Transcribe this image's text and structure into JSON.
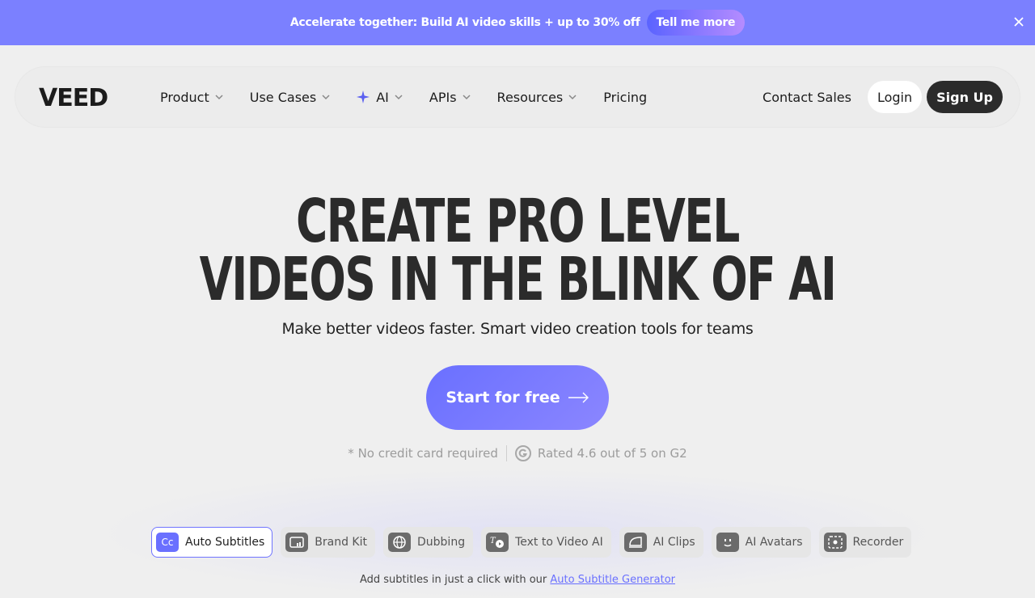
{
  "banner": {
    "text": "Accelerate together: Build AI video skills + up to 30% off",
    "button": "Tell me more",
    "close_icon": "close-icon",
    "color": "#7b80ff"
  },
  "nav": {
    "logo": "VEED",
    "items": [
      {
        "label": "Product",
        "dropdown": true
      },
      {
        "label": "Use Cases",
        "dropdown": true
      },
      {
        "label": "AI",
        "dropdown": true,
        "icon": "sparkle-icon"
      },
      {
        "label": "APIs",
        "dropdown": true
      },
      {
        "label": "Resources",
        "dropdown": true
      },
      {
        "label": "Pricing",
        "dropdown": false
      }
    ],
    "contact": "Contact Sales",
    "login": "Login",
    "signup": "Sign Up"
  },
  "hero": {
    "title_line1": "CREATE PRO LEVEL",
    "title_line2": "VIDEOS IN THE BLINK OF AI",
    "subtitle": "Make better videos faster. Smart video creation tools for teams",
    "cta": "Start for free",
    "no_card": "* No credit card required",
    "rating": "Rated 4.6 out of 5 on G2"
  },
  "tools": [
    {
      "label": "Auto Subtitles",
      "icon": "cc-icon",
      "active": true
    },
    {
      "label": "Brand Kit",
      "icon": "brand-kit-icon",
      "active": false
    },
    {
      "label": "Dubbing",
      "icon": "globe-icon",
      "active": false
    },
    {
      "label": "Text to Video AI",
      "icon": "text-video-icon",
      "active": false
    },
    {
      "label": "AI Clips",
      "icon": "clips-icon",
      "active": false
    },
    {
      "label": "AI Avatars",
      "icon": "avatar-icon",
      "active": false
    },
    {
      "label": "Recorder",
      "icon": "recorder-icon",
      "active": false
    }
  ],
  "bottom": {
    "text": "Add subtitles in just a click with our",
    "link": "Auto Subtitle Generator"
  },
  "colors": {
    "accent": "#6a70ff",
    "dark": "#2b2b2b",
    "background": "#efefef"
  }
}
